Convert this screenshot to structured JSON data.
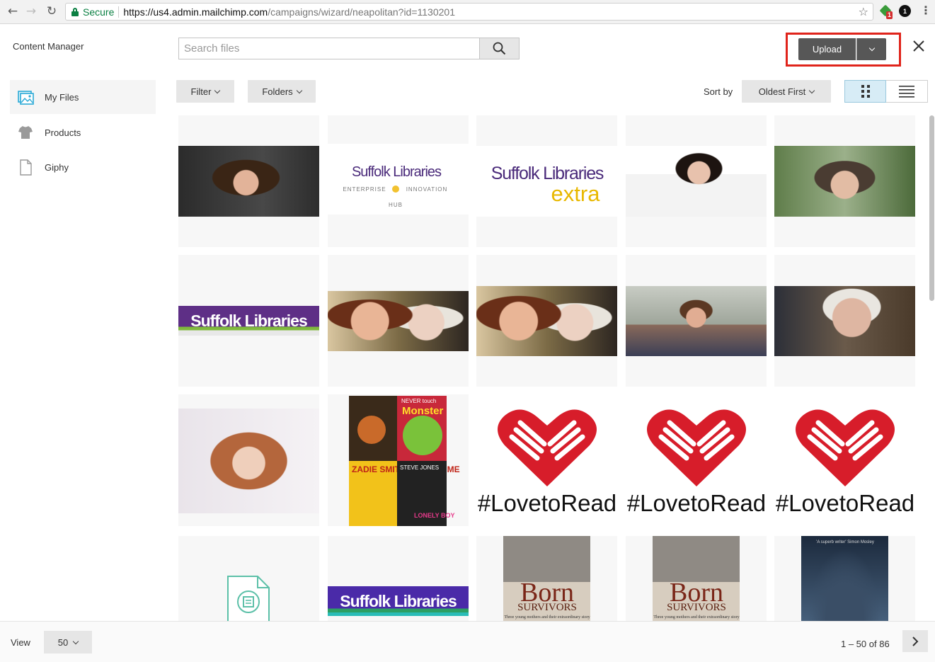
{
  "browser": {
    "secure_label": "Secure",
    "url_host": "https://us4.admin.mailchimp.com",
    "url_path": "/campaigns/wizard/neapolitan?id=1130201",
    "extension_badge": "1",
    "profile_badge": "1"
  },
  "header": {
    "title": "Content Manager",
    "search_placeholder": "Search files",
    "upload_label": "Upload"
  },
  "sidebar": {
    "items": [
      {
        "label": "My Files",
        "icon": "image-folder-icon",
        "active": true
      },
      {
        "label": "Products",
        "icon": "tshirt-icon",
        "active": false
      },
      {
        "label": "Giphy",
        "icon": "file-icon",
        "active": false
      }
    ]
  },
  "toolbar": {
    "filter_label": "Filter",
    "folders_label": "Folders",
    "sort_by_label": "Sort by",
    "sort_value": "Oldest First",
    "view_modes": [
      "grid-view-icon",
      "list-view-icon"
    ]
  },
  "files": [
    {
      "kind": "photo",
      "style": "portrait1"
    },
    {
      "kind": "logo-enterprise",
      "title": "Suffolk Libraries",
      "sub_left": "ENTERPRISE",
      "sub_right": "INNOVATION",
      "sub_bottom": "HUB"
    },
    {
      "kind": "logo-extra",
      "title": "Suffolk Libraries",
      "extra": "extra"
    },
    {
      "kind": "photo",
      "style": "portrait-red"
    },
    {
      "kind": "photo",
      "style": "portrait-green"
    },
    {
      "kind": "banner",
      "title": "Suffolk Libraries"
    },
    {
      "kind": "photo",
      "style": "portrait-duo"
    },
    {
      "kind": "photo",
      "style": "portrait-duo"
    },
    {
      "kind": "photo",
      "style": "portrait-white"
    },
    {
      "kind": "photo",
      "style": "portrait-man"
    },
    {
      "kind": "photo",
      "style": "portrait-curly"
    },
    {
      "kind": "books",
      "texts": [
        "NEVER touch",
        "Monster",
        "ZADIE SMITH SWING TIME",
        "STEVE JONES",
        "LONELY BOY"
      ]
    },
    {
      "kind": "loveread",
      "title": "#LovetoRead"
    },
    {
      "kind": "loveread",
      "title": "#LovetoRead"
    },
    {
      "kind": "loveread",
      "title": "#LovetoRead"
    },
    {
      "kind": "document"
    },
    {
      "kind": "banner2",
      "title": "Suffolk Libraries"
    },
    {
      "kind": "born",
      "title": "Born",
      "subtitle": "SURVIVORS",
      "tagline": "Three young mothers and their extraordinary story"
    },
    {
      "kind": "born",
      "title": "Born",
      "subtitle": "SURVIVORS",
      "tagline": "Three young mothers and their extraordinary story"
    },
    {
      "kind": "book-dark",
      "quote": "'A superb writer' Simon Mosley"
    }
  ],
  "footer": {
    "view_label": "View",
    "per_page": "50",
    "range_text": "1 – 50 of 86"
  },
  "colors": {
    "highlight_box": "#e0241b",
    "upload_button": "#575757",
    "active_view": "#d7ecf6",
    "suffolk_purple": "#5e2f86",
    "love_red": "#d71d2a"
  }
}
